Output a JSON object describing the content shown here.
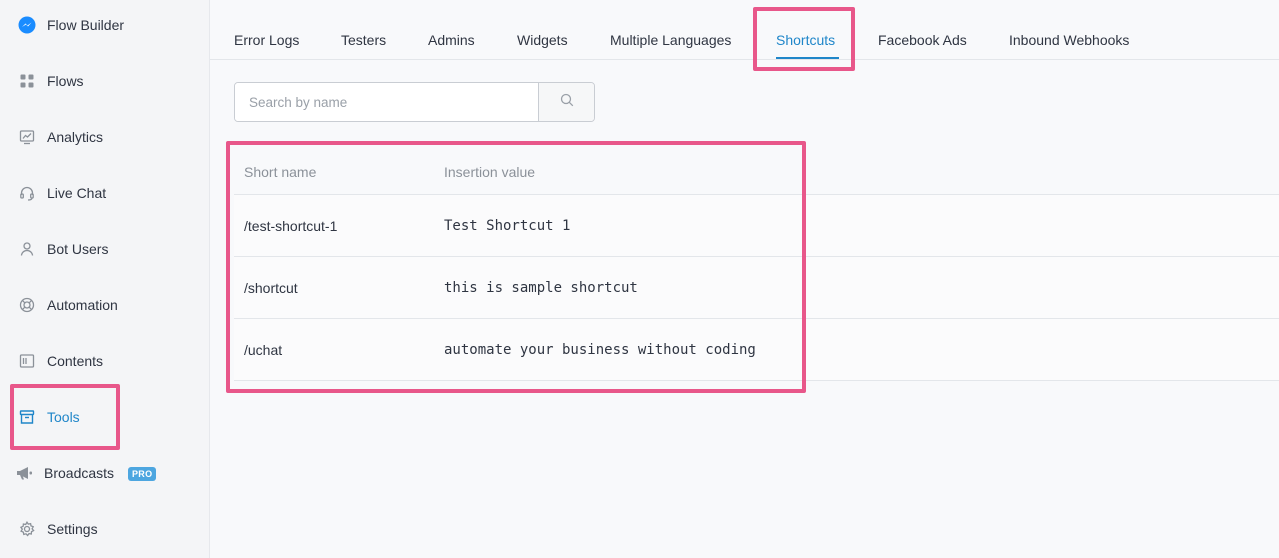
{
  "sidebar": {
    "items": [
      {
        "label": "Flow Builder",
        "icon": "messenger-icon"
      },
      {
        "label": "Flows",
        "icon": "grid-icon"
      },
      {
        "label": "Analytics",
        "icon": "chart-icon"
      },
      {
        "label": "Live Chat",
        "icon": "headset-icon"
      },
      {
        "label": "Bot Users",
        "icon": "user-icon"
      },
      {
        "label": "Automation",
        "icon": "lifebuoy-icon"
      },
      {
        "label": "Contents",
        "icon": "content-icon"
      },
      {
        "label": "Tools",
        "icon": "archive-icon"
      },
      {
        "label": "Broadcasts",
        "icon": "megaphone-icon",
        "badge": "PRO"
      },
      {
        "label": "Settings",
        "icon": "gear-icon"
      }
    ],
    "active": "Tools"
  },
  "tabs": {
    "items": [
      "Error Logs",
      "Testers",
      "Admins",
      "Widgets",
      "Multiple Languages",
      "Shortcuts",
      "Facebook Ads",
      "Inbound Webhooks"
    ],
    "active": "Shortcuts"
  },
  "search": {
    "placeholder": "Search by name",
    "value": ""
  },
  "table": {
    "columns": [
      "Short name",
      "Insertion value"
    ],
    "rows": [
      {
        "short_name": "/test-shortcut-1",
        "insertion_value": "Test Shortcut 1"
      },
      {
        "short_name": "/shortcut",
        "insertion_value": "this is sample shortcut"
      },
      {
        "short_name": "/uchat",
        "insertion_value": "automate your business without coding"
      }
    ]
  },
  "colors": {
    "accent": "#1f86c9",
    "highlight": "#e8578a",
    "messenger": "#1a8cff",
    "pro_badge": "#4da6e0"
  }
}
